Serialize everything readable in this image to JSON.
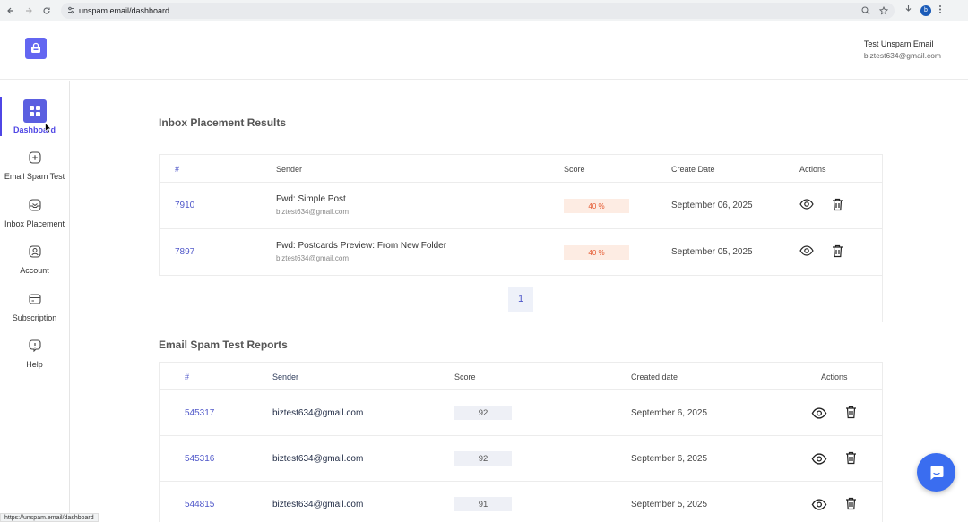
{
  "browser": {
    "url": "unspam.email/dashboard",
    "status_url": "https://unspam.email/dashboard",
    "profile_initial": "b"
  },
  "header": {
    "user_name": "Test Unspam Email",
    "user_email": "biztest634@gmail.com"
  },
  "sidebar": {
    "items": [
      {
        "label": "Dashboard",
        "icon": "grid-icon",
        "active": true
      },
      {
        "label": "Email Spam Test",
        "icon": "plus-square-icon"
      },
      {
        "label": "Inbox Placement",
        "icon": "inbox-icon"
      },
      {
        "label": "Account",
        "icon": "user-icon"
      },
      {
        "label": "Subscription",
        "icon": "credit-card-icon"
      },
      {
        "label": "Help",
        "icon": "help-icon"
      }
    ]
  },
  "inbox_placement": {
    "title": "Inbox Placement Results",
    "columns": [
      "#",
      "Sender",
      "Score",
      "Create Date",
      "Actions"
    ],
    "rows": [
      {
        "id": "7910",
        "subject": "Fwd: Simple Post",
        "email": "biztest634@gmail.com",
        "score": "40 %",
        "date": "September 06, 2025"
      },
      {
        "id": "7897",
        "subject": "Fwd: Postcards Preview: From New Folder",
        "email": "biztest634@gmail.com",
        "score": "40 %",
        "date": "September 05, 2025"
      }
    ],
    "page": "1"
  },
  "spam_reports": {
    "title": "Email Spam Test Reports",
    "columns": [
      "#",
      "Sender",
      "Score",
      "Created date",
      "Actions"
    ],
    "rows": [
      {
        "id": "545317",
        "sender": "biztest634@gmail.com",
        "score": "92",
        "date": "September 6, 2025"
      },
      {
        "id": "545316",
        "sender": "biztest634@gmail.com",
        "score": "92",
        "date": "September 6, 2025"
      },
      {
        "id": "544815",
        "sender": "biztest634@gmail.com",
        "score": "91",
        "date": "September 5, 2025"
      }
    ]
  },
  "colors": {
    "accent": "#4f46e5",
    "score_bad_bg": "#fdece3",
    "score_bad_text": "#e4572e",
    "chat": "#3a6df0"
  }
}
